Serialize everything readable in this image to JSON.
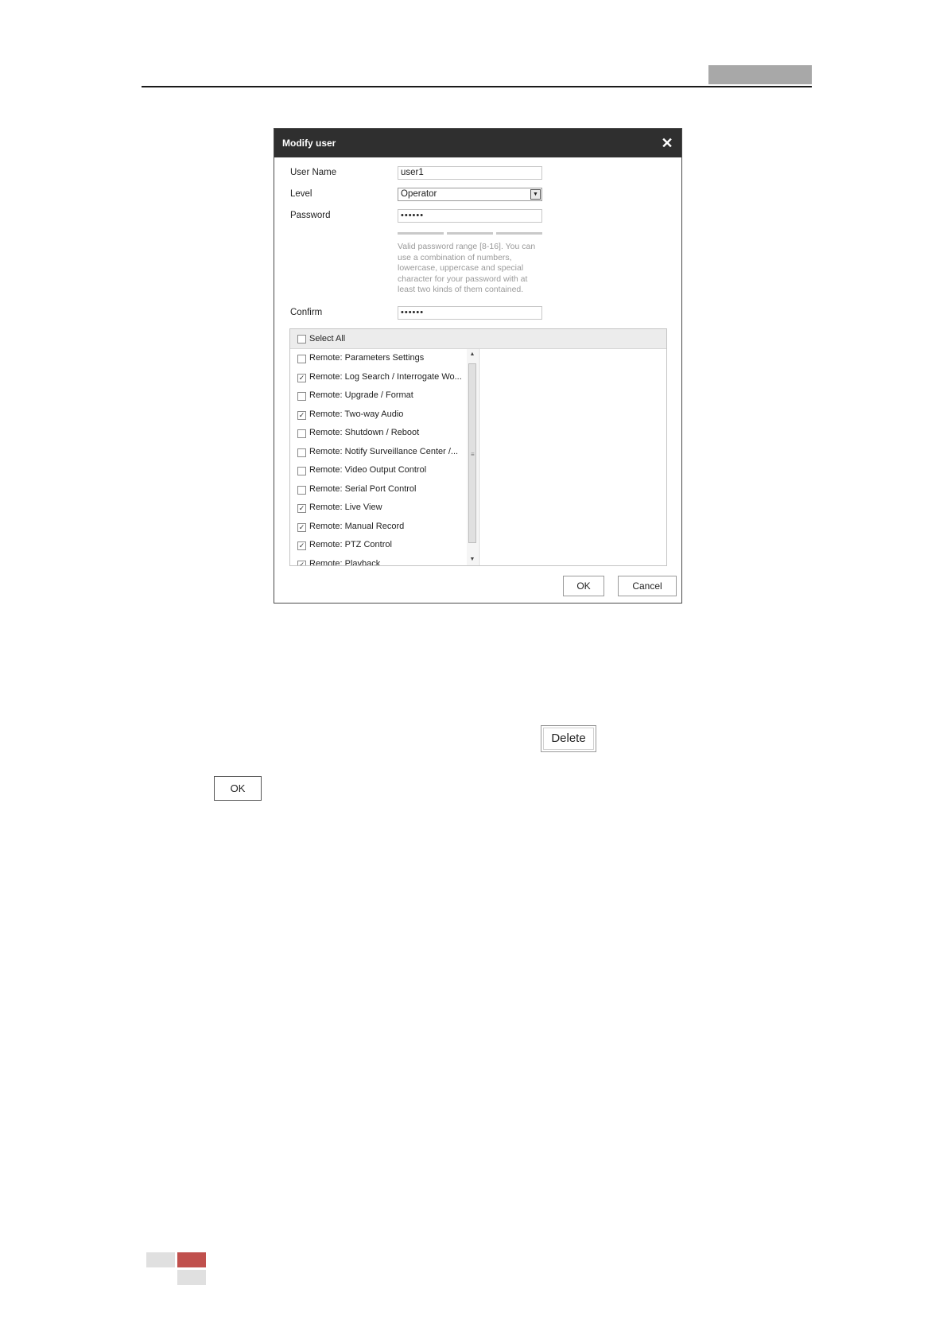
{
  "dialog": {
    "title": "Modify user",
    "close_glyph": "✕",
    "user_name_label": "User Name",
    "user_name_value": "user1",
    "level_label": "Level",
    "level_value": "Operator",
    "password_label": "Password",
    "password_value": "••••••",
    "password_hint": "Valid password range [8-16]. You can use a combination of numbers, lowercase, uppercase and special character for your password with at least two kinds of them contained.",
    "confirm_label": "Confirm",
    "confirm_value": "••••••",
    "select_all_label": "Select All",
    "permissions": [
      {
        "label": "Remote: Parameters Settings",
        "checked": false
      },
      {
        "label": "Remote: Log Search / Interrogate Wo...",
        "checked": true
      },
      {
        "label": "Remote: Upgrade / Format",
        "checked": false
      },
      {
        "label": "Remote: Two-way Audio",
        "checked": true
      },
      {
        "label": "Remote: Shutdown / Reboot",
        "checked": false
      },
      {
        "label": "Remote: Notify Surveillance Center /...",
        "checked": false
      },
      {
        "label": "Remote: Video Output Control",
        "checked": false
      },
      {
        "label": "Remote: Serial Port Control",
        "checked": false
      },
      {
        "label": "Remote: Live View",
        "checked": true
      },
      {
        "label": "Remote: Manual Record",
        "checked": true
      },
      {
        "label": "Remote: PTZ Control",
        "checked": true
      },
      {
        "label": "Remote: Playback",
        "checked": true
      }
    ],
    "ok_label": "OK",
    "cancel_label": "Cancel"
  },
  "page": {
    "delete_label": "Delete",
    "ok_label": "OK"
  },
  "colors": {
    "title_bar": "#2f2f2f",
    "header_tab": "#a8a8a8",
    "footer_red": "#c0504d",
    "footer_grey": "#e0e0e0"
  }
}
